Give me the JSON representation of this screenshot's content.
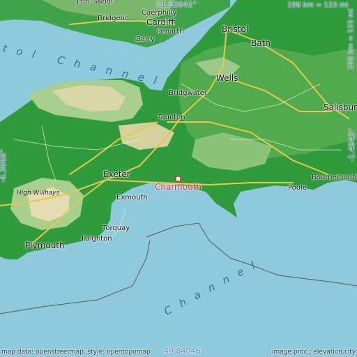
{
  "map": {
    "target_place": "Charmouth",
    "colors": {
      "sea": "#8fc9dc",
      "lowland": "#2f9b3c",
      "midland": "#8cc37a",
      "upland": "#d9d6a8",
      "road": "#e8c84a",
      "target": "#d9242a"
    },
    "coordinates": {
      "top": "51.62041°",
      "bottom": "49.84046°",
      "left": "-4.3068°",
      "right": "-1.4943°"
    },
    "scale_top": "198 km = 123 mi",
    "scale_right": "198 km = 123 mi",
    "sea_labels": {
      "bristol_channel": "tol Channel",
      "english_channel": "Channel"
    },
    "towns": {
      "port_talbot": "Port Talbot",
      "bridgend": "Bridgend",
      "caerphilly": "Caerphilly",
      "cardiff": "Cardiff",
      "penarth": "Penarth",
      "barry": "Barry",
      "bristol": "Bristol",
      "bath": "Bath",
      "wells": "Wells",
      "bridgwater": "Bridgwater",
      "taunton": "Taunton",
      "salisbury": "Salisbury",
      "exeter": "Exeter",
      "exmouth": "Exmouth",
      "torquay": "Torquay",
      "paignton": "Paignton",
      "plymouth": "Plymouth",
      "poole": "Poole",
      "bournemouth": "Bournemouth"
    },
    "hill": "High Willhays",
    "credits": {
      "left": "map data: openstreetmap, style: opentopomap",
      "right": "image proc.: elevation.city"
    }
  }
}
